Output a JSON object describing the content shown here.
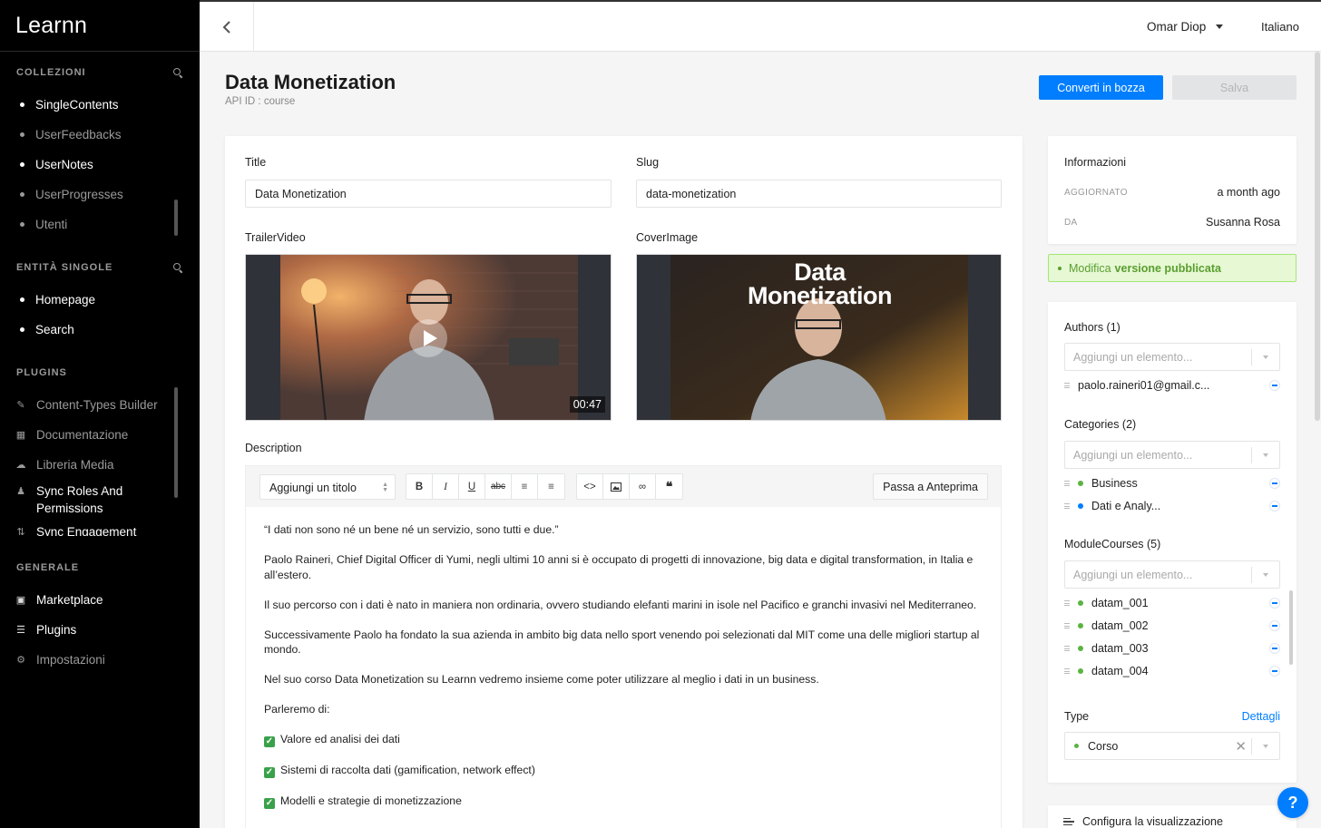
{
  "app": {
    "logo": "Learnn"
  },
  "sidebar": {
    "collections": {
      "title": "COLLEZIONI",
      "items": [
        {
          "label": "SingleContents",
          "active": true
        },
        {
          "label": "UserFeedbacks",
          "active": false
        },
        {
          "label": "UserNotes",
          "active": true
        },
        {
          "label": "UserProgresses",
          "active": false
        },
        {
          "label": "Utenti",
          "active": false
        }
      ]
    },
    "single_types": {
      "title": "ENTITÀ SINGOLE",
      "items": [
        {
          "label": "Homepage"
        },
        {
          "label": "Search"
        }
      ]
    },
    "plugins": {
      "title": "PLUGINS",
      "items": [
        {
          "label": "Content-Types Builder",
          "icon": "brush-icon"
        },
        {
          "label": "Documentazione",
          "icon": "book-icon"
        },
        {
          "label": "Libreria Media",
          "icon": "cloud-upload-icon"
        },
        {
          "label": "Sync Roles And Permissions",
          "icon": "users-icon"
        },
        {
          "label": "Sync Engagement",
          "icon": "sync-icon"
        }
      ]
    },
    "general": {
      "title": "GENERALE",
      "items": [
        {
          "label": "Marketplace",
          "icon": "shop-icon"
        },
        {
          "label": "Plugins",
          "icon": "list-icon"
        },
        {
          "label": "Impostazioni",
          "icon": "gear-icon"
        }
      ]
    }
  },
  "topbar": {
    "user": "Omar Diop",
    "language": "Italiano"
  },
  "header": {
    "title": "Data Monetization",
    "api_id": "API ID : course",
    "convert_label": "Converti in bozza",
    "save_label": "Salva"
  },
  "form": {
    "title_label": "Title",
    "title_value": "Data Monetization",
    "slug_label": "Slug",
    "slug_value": "data-monetization",
    "trailer_label": "TrailerVideo",
    "trailer_duration": "00:47",
    "cover_label": "CoverImage",
    "cover_text_line1": "Data",
    "cover_text_line2": "Monetization",
    "description_label": "Description",
    "heading_select": "Aggiungi un titolo",
    "preview_label": "Passa a Anteprima",
    "description": [
      "“I dati non sono né un bene né un servizio, sono tutti e due.”",
      "Paolo Raineri, Chief Digital Officer di Yumi, negli ultimi 10 anni si è occupato di progetti di innovazione, big data e digital transformation, in Italia e all’estero.",
      "Il suo percorso con i dati è nato in maniera non ordinaria, ovvero studiando elefanti marini in isole nel Pacifico e granchi invasivi nel Mediterraneo.",
      "Successivamente Paolo ha fondato la sua azienda in ambito big data nello sport venendo poi selezionati dal MIT come una delle migliori startup al mondo.",
      "Nel suo corso Data Monetization su Learnn vedremo insieme come poter utilizzare al meglio i dati in un business.",
      "Parleremo di:"
    ],
    "checklist": [
      "Valore ed analisi dei dati",
      "Sistemi di raccolta dati (gamification, network effect)",
      "Modelli e strategie di monetizzazione"
    ]
  },
  "info": {
    "title": "Informazioni",
    "updated_key": "AGGIORNATO",
    "updated_value": "a month ago",
    "by_key": "DA",
    "by_value": "Susanna Rosa"
  },
  "alert": {
    "prefix": "Modifica",
    "bold": "versione pubblicata"
  },
  "relations": {
    "placeholder": "Aggiungi un elemento...",
    "authors": {
      "label": "Authors (1)",
      "items": [
        "paolo.raineri01@gmail.c..."
      ]
    },
    "categories": {
      "label": "Categories (2)",
      "items": [
        {
          "name": "Business",
          "color": "#5ab440"
        },
        {
          "name": "Dati e Analy...",
          "color": "#007eff"
        }
      ]
    },
    "modules": {
      "label": "ModuleCourses (5)",
      "items": [
        "datam_001",
        "datam_002",
        "datam_003",
        "datam_004"
      ],
      "color": "#5ab440"
    },
    "type": {
      "label": "Type",
      "link": "Dettagli",
      "value": "Corso"
    }
  },
  "config": {
    "label": "Configura la visualizzazione"
  },
  "colors": {
    "accent": "#007eff",
    "success": "#5ab440",
    "sidebar": "#000000"
  }
}
